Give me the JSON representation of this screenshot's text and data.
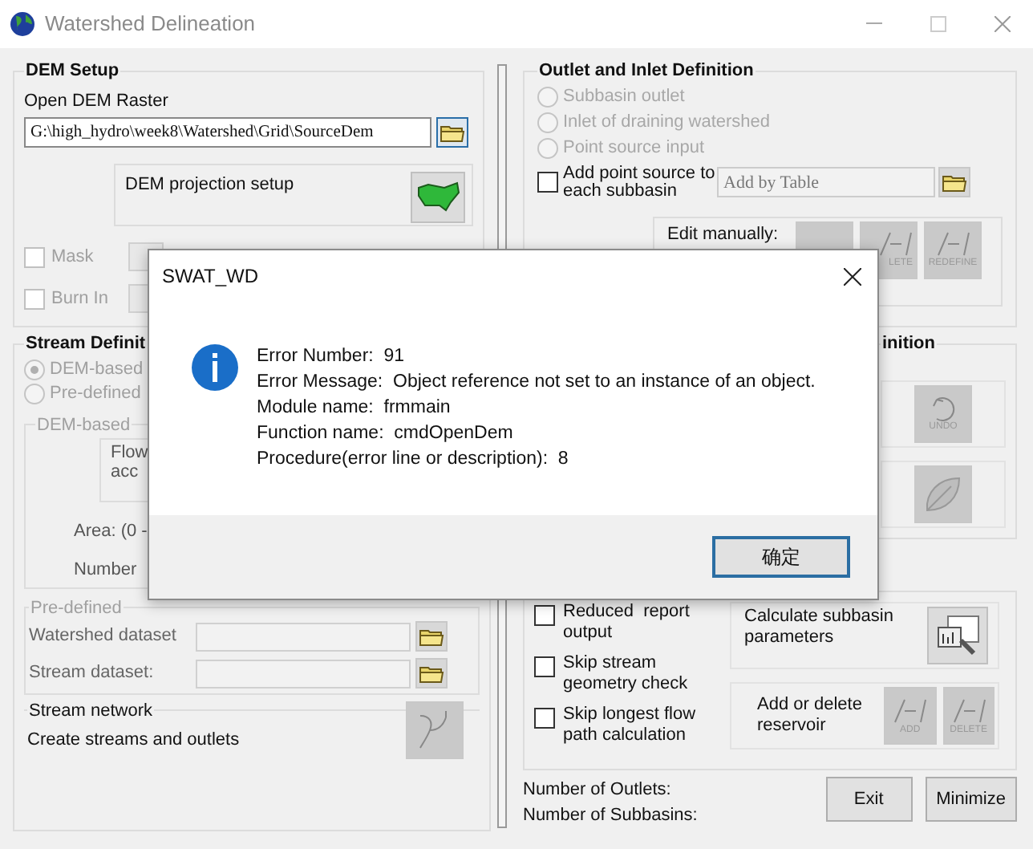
{
  "window": {
    "title": "Watershed Delineation"
  },
  "dem_setup": {
    "title": "DEM Setup",
    "open_label": "Open DEM Raster",
    "path": "G:\\high_hydro\\week8\\Watershed\\Grid\\SourceDem",
    "projection_label": "DEM projection setup",
    "options": [
      {
        "label": "Mask",
        "checked": false,
        "disabled": true
      },
      {
        "label": "Burn In",
        "checked": false,
        "disabled": true
      }
    ]
  },
  "stream_definition": {
    "title": "Stream Definit",
    "methods": [
      {
        "label": "DEM-based",
        "selected": true,
        "disabled": true
      },
      {
        "label": "Pre-defined",
        "selected": false,
        "disabled": true
      }
    ],
    "dem_based": {
      "title": "DEM-based",
      "flow_lines": [
        "Flow",
        "acc"
      ],
      "area_label": "Area: (0 -",
      "number_label": "Number"
    },
    "pre_defined": {
      "title": "Pre-defined",
      "fields": [
        {
          "label": "Watershed dataset"
        },
        {
          "label": "Stream dataset:"
        }
      ]
    },
    "stream_network": {
      "title": "Stream network",
      "label": "Create streams and outlets"
    }
  },
  "outlet_inlet": {
    "title": "Outlet and Inlet Definition",
    "options": [
      {
        "label": "Subbasin outlet",
        "selected": false,
        "disabled": true
      },
      {
        "label": "Inlet of draining watershed",
        "selected": false,
        "disabled": true
      },
      {
        "label": "Point source input",
        "selected": false,
        "disabled": true
      }
    ],
    "point_source": {
      "label": "Add point source to each subbasin",
      "checked": false
    },
    "table_placeholder": "Add by Table",
    "edit_label": "Edit manually:",
    "edit_captions": [
      "LETE",
      "REDEFINE"
    ]
  },
  "outlet_selection": {
    "title": "inition",
    "undo_caption": "UNDO"
  },
  "calculation": {
    "options": [
      {
        "label": "Reduced  report output",
        "checked": false
      },
      {
        "label": "Skip stream geometry check",
        "checked": false
      },
      {
        "label": "Skip longest flow path calculation",
        "checked": false
      }
    ],
    "calculate_label": "Calculate subbasin parameters",
    "reservoir_label": "Add or delete reservoir",
    "reservoir_captions": [
      "ADD",
      "DELETE"
    ]
  },
  "status": [
    "Number of Outlets:",
    "Number of Subbasins:"
  ],
  "buttons": [
    "Exit",
    "Minimize"
  ],
  "dialog": {
    "title": "SWAT_WD",
    "lines": [
      "Error Number:  91",
      "Error Message:  Object reference not set to an instance of an object.",
      "Module name:  frmmain",
      "Function name:  cmdOpenDem",
      "Procedure(error line or description):  8"
    ],
    "ok": "确定"
  }
}
